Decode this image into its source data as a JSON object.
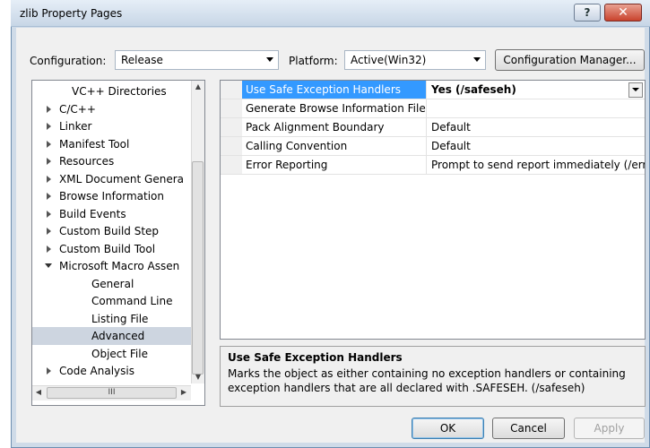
{
  "window": {
    "title": "zlib Property Pages",
    "help_glyph": "?",
    "close_glyph": "✕"
  },
  "top": {
    "configuration_label": "Configuration:",
    "configuration_value": "Release",
    "platform_label": "Platform:",
    "platform_value": "Active(Win32)",
    "config_manager_label": "Configuration Manager..."
  },
  "tree": {
    "items": [
      {
        "label": "VC++ Directories"
      },
      {
        "label": "C/C++"
      },
      {
        "label": "Linker"
      },
      {
        "label": "Manifest Tool"
      },
      {
        "label": "Resources"
      },
      {
        "label": "XML Document Genera"
      },
      {
        "label": "Browse Information"
      },
      {
        "label": "Build Events"
      },
      {
        "label": "Custom Build Step"
      },
      {
        "label": "Custom Build Tool"
      },
      {
        "label": "Microsoft Macro Assen"
      },
      {
        "label": "General"
      },
      {
        "label": "Command Line"
      },
      {
        "label": "Listing File"
      },
      {
        "label": "Advanced"
      },
      {
        "label": "Object File"
      },
      {
        "label": "Code Analysis"
      }
    ],
    "hscroll_grip": "III"
  },
  "properties": {
    "rows": [
      {
        "name": "Use Safe Exception Handlers",
        "value": "Yes (/safeseh)"
      },
      {
        "name": "Generate Browse Information File",
        "value": ""
      },
      {
        "name": "Pack Alignment Boundary",
        "value": "Default"
      },
      {
        "name": "Calling Convention",
        "value": "Default"
      },
      {
        "name": "Error Reporting",
        "value": "Prompt to send report immediately (/errorReport:prompt)"
      }
    ]
  },
  "description": {
    "title": "Use Safe Exception Handlers",
    "line1": "Marks the object as either containing no exception handlers or containing",
    "line2": "exception handlers that are all declared with .SAFESEH.     (/safeseh)"
  },
  "buttons": {
    "ok": "OK",
    "cancel": "Cancel",
    "apply": "Apply"
  }
}
